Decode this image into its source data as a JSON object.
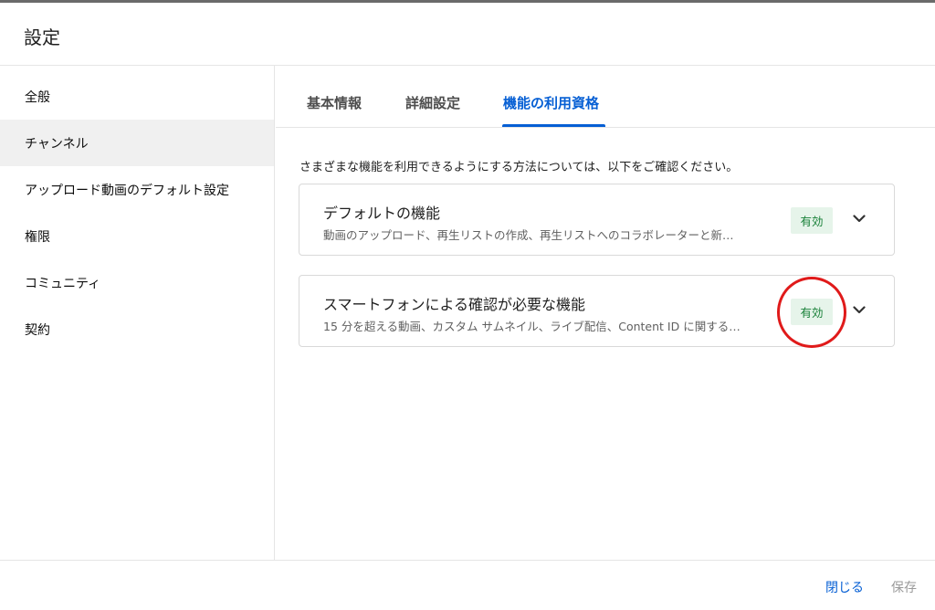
{
  "header": {
    "title": "設定"
  },
  "sidebar": {
    "items": [
      {
        "label": "全般"
      },
      {
        "label": "チャンネル"
      },
      {
        "label": "アップロード動画のデフォルト設定"
      },
      {
        "label": "権限"
      },
      {
        "label": "コミュニティ"
      },
      {
        "label": "契約"
      }
    ],
    "active_index": 1
  },
  "tabs": [
    {
      "label": "基本情報"
    },
    {
      "label": "詳細設定"
    },
    {
      "label": "機能の利用資格"
    }
  ],
  "active_tab": 2,
  "intro_text": "さまざまな機能を利用できるようにする方法については、以下をご確認ください。",
  "cards": [
    {
      "title": "デフォルトの機能",
      "description": "動画のアップロード、再生リストの作成、再生リストへのコラボレーターと新…",
      "status": "有効"
    },
    {
      "title": "スマートフォンによる確認が必要な機能",
      "description": "15 分を超える動画、カスタム サムネイル、ライブ配信、Content ID に関する…",
      "status": "有効"
    }
  ],
  "footer": {
    "close_label": "閉じる",
    "save_label": "保存"
  },
  "colors": {
    "accent": "#065fd4",
    "badge_bg": "#e6f4ea",
    "badge_text": "#188038",
    "annotation": "#e01a1a"
  },
  "icons": {
    "expand": "chevron-down-icon"
  }
}
